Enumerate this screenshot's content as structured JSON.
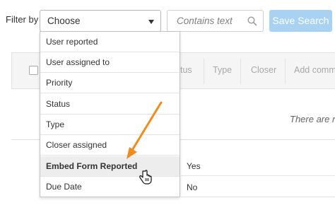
{
  "filter": {
    "label": "Filter by",
    "selected": "Choose"
  },
  "search": {
    "placeholder": "Contains text"
  },
  "save_button": {
    "label": "Save Search"
  },
  "table": {
    "columns": [
      "tus",
      "Type",
      "Closer",
      "Add comme"
    ],
    "empty_message": "There are r",
    "rows": [
      {
        "value": "Yes"
      },
      {
        "value": "No"
      }
    ]
  },
  "dropdown": {
    "options": [
      "User reported",
      "User assigned to",
      "Priority",
      "Status",
      "Type",
      "Closer assigned",
      "Embed Form Reported",
      "Due Date"
    ],
    "hovered_index": 6
  },
  "colors": {
    "save_button_bg": "#a9d2f2",
    "annotation_arrow": "#f28a1d"
  },
  "icons": {
    "search": "magnifier-icon",
    "select": "caret-down-icon",
    "pointer": "hand-cursor-icon"
  }
}
